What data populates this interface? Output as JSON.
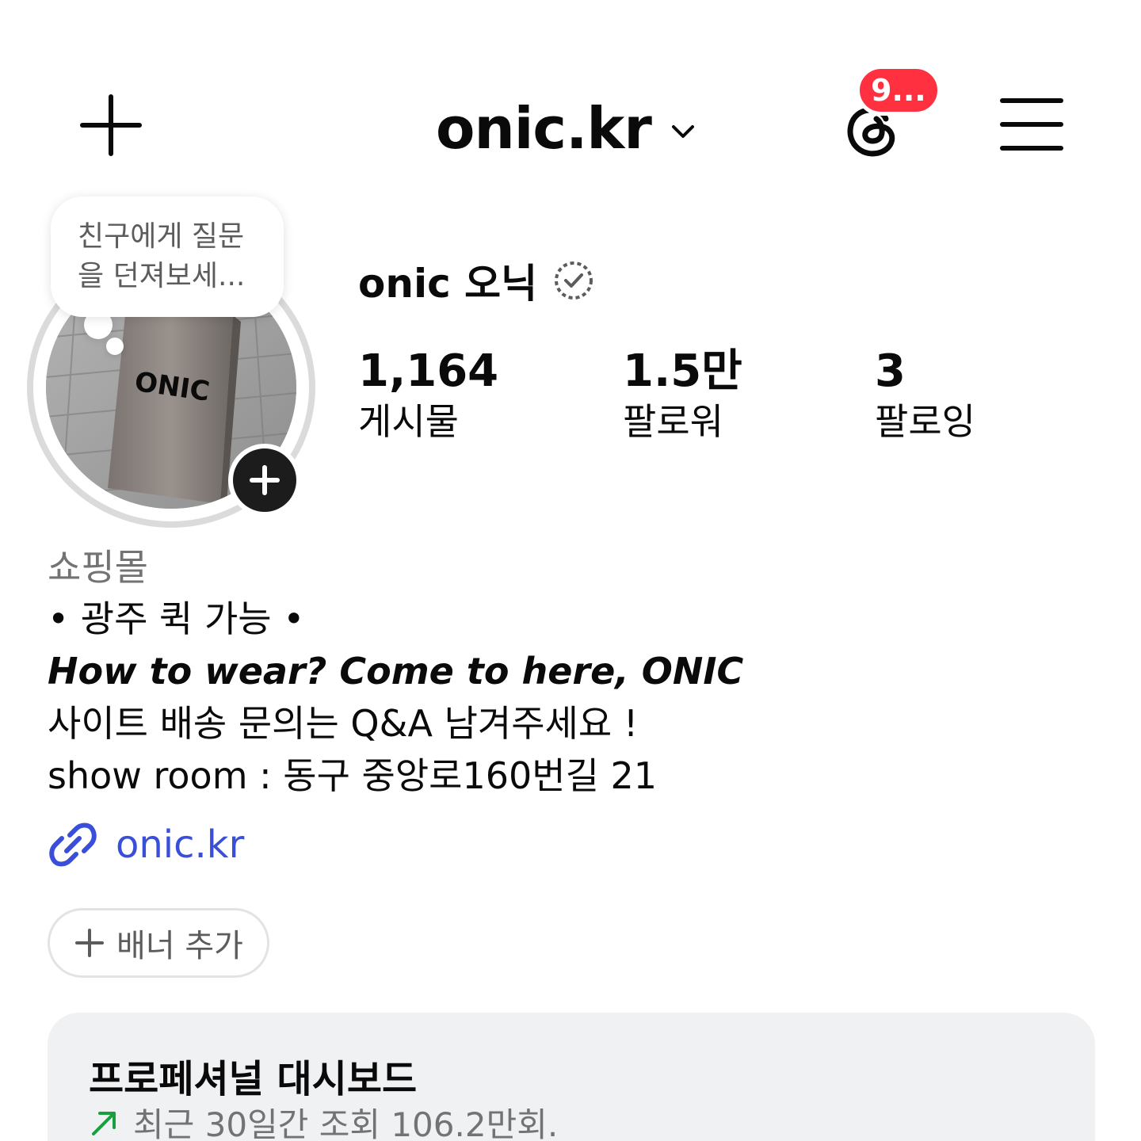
{
  "header": {
    "username": "onic.kr",
    "notification_count": "9...",
    "icons": {
      "create": "plus-icon",
      "account_switch": "chevron-down-icon",
      "threads": "threads-icon",
      "menu": "hamburger-menu-icon"
    },
    "badge_color": "#ff3040"
  },
  "profile": {
    "note": "친구에게 질문을 던져보세...",
    "display_name": "onic 오닉",
    "avatar_text": "ONIC",
    "stats": {
      "posts": {
        "value": "1,164",
        "label": "게시물"
      },
      "followers": {
        "value": "1.5만",
        "label": "팔로워"
      },
      "following": {
        "value": "3",
        "label": "팔로잉"
      }
    }
  },
  "bio": {
    "category": "쇼핑몰",
    "lines": [
      "• 광주 퀵 가능 •",
      "How to wear? Come to here, ONIC",
      "사이트 배송 문의는 Q&A 남겨주세요 !",
      "show room : 동구 중앙로160번길 21"
    ],
    "link": "onic.kr",
    "link_color": "#3a4fd9"
  },
  "banner_button": {
    "label": "배너 추가"
  },
  "dashboard": {
    "title": "프로페셔널 대시보드",
    "subtitle": "최근 30일간 조회 106.2만회.",
    "trend_color": "#1a9e3f"
  }
}
